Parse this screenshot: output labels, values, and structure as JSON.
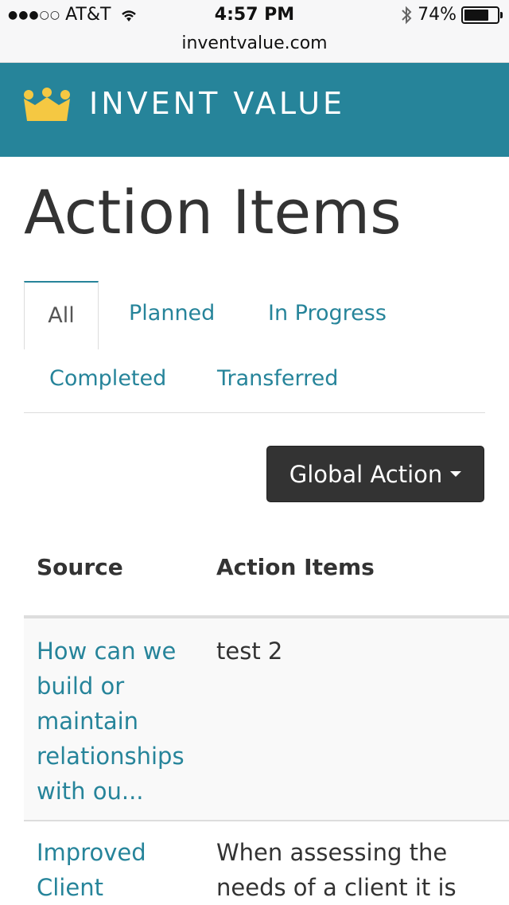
{
  "status_bar": {
    "carrier": "AT&T",
    "time": "4:57 PM",
    "battery": "74%",
    "battery_level": 0.74,
    "url": "inventvalue.com"
  },
  "navbar": {
    "brand": "INVENT VALUE",
    "logo_icon": "crown-icon",
    "logo_color": "#f5c842",
    "bg_color": "#26849a"
  },
  "page": {
    "title": "Action Items"
  },
  "tabs": [
    {
      "label": "All",
      "active": true
    },
    {
      "label": "Planned",
      "active": false
    },
    {
      "label": "In Progress",
      "active": false
    },
    {
      "label": "Completed",
      "active": false
    },
    {
      "label": "Transferred",
      "active": false
    }
  ],
  "global_action": {
    "label": "Global Action"
  },
  "table": {
    "columns": [
      "Source",
      "Action Items"
    ],
    "rows": [
      {
        "source": "How can we build or maintain relationships with ou...",
        "action": "test 2"
      },
      {
        "source": "Improved Client",
        "action": "When assessing the needs of a client it is"
      }
    ]
  }
}
